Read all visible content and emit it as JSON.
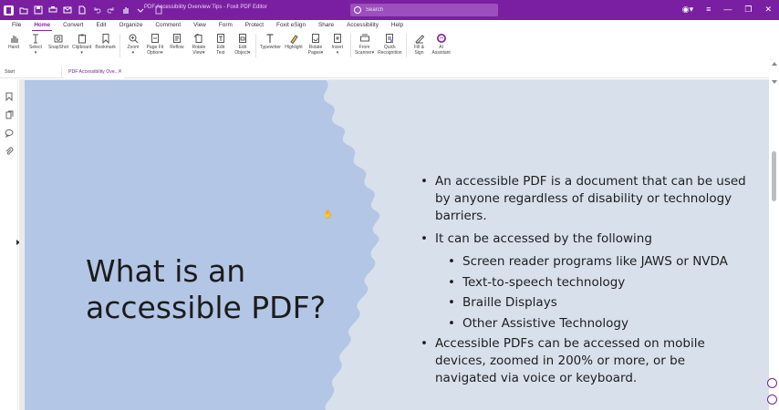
{
  "window": {
    "doc_title": "PDF Accessibility Overview Tips - Foxit PDF Editor",
    "search_placeholder": "Search"
  },
  "menu": [
    "File",
    "Home",
    "Convert",
    "Edit",
    "Organize",
    "Comment",
    "View",
    "Form",
    "Protect",
    "Foxit eSign",
    "Share",
    "Accessibility",
    "Help"
  ],
  "menu_active": "Home",
  "ribbon": [
    {
      "label": "Hand",
      "icon": "hand-icon"
    },
    {
      "label": "Select\n▾",
      "icon": "select-icon"
    },
    {
      "label": "SnapShot",
      "icon": "snapshot-icon"
    },
    {
      "label": "Clipboard\n▾",
      "icon": "clipboard-icon"
    },
    {
      "label": "Bookmark",
      "icon": "bookmark-icon"
    },
    {
      "label": "Zoom\n▾",
      "icon": "zoom-icon"
    },
    {
      "label": "Page Fit\nOption▾",
      "icon": "page-fit-icon"
    },
    {
      "label": "Reflow",
      "icon": "reflow-icon"
    },
    {
      "label": "Rotate\nView▾",
      "icon": "rotate-view-icon"
    },
    {
      "label": "Edit\nText",
      "icon": "edit-text-icon"
    },
    {
      "label": "Edit\nObject▾",
      "icon": "edit-object-icon"
    },
    {
      "label": "Typewriter",
      "icon": "typewriter-icon"
    },
    {
      "label": "Highlight",
      "icon": "highlight-icon"
    },
    {
      "label": "Rotate\nPages▾",
      "icon": "rotate-pages-icon"
    },
    {
      "label": "Insert\n▾",
      "icon": "insert-icon"
    },
    {
      "label": "From\nScanner▾",
      "icon": "scanner-icon"
    },
    {
      "label": "Quick\nRecognition",
      "icon": "recognition-icon"
    },
    {
      "label": "Fill &\nSign",
      "icon": "fill-sign-icon"
    },
    {
      "label": "AI\nAssistant",
      "icon": "ai-assistant-icon"
    }
  ],
  "tabs": {
    "start": "Start",
    "document": "PDF Accessibility Ove..."
  },
  "colors": {
    "brand": "#7b1fa2",
    "slide_bg": "#d8e0ec",
    "slide_splash": "#b3c6e6"
  },
  "slide": {
    "title": "What is an accessible PDF?",
    "bullets": [
      {
        "level": 1,
        "text": "An accessible PDF is a document that can be used by anyone regardless of disability or technology barriers."
      },
      {
        "level": 1,
        "text": "It can be accessed by the following"
      },
      {
        "level": 2,
        "text": "Screen reader programs like JAWS or NVDA"
      },
      {
        "level": 2,
        "text": "Text-to-speech technology"
      },
      {
        "level": 2,
        "text": "Braille Displays"
      },
      {
        "level": 2,
        "text": "Other Assistive Technology"
      },
      {
        "level": 1,
        "text": "Accessible PDFs can be accessed on mobile devices, zoomed in 200% or more, or be navigated via voice or keyboard."
      }
    ]
  }
}
